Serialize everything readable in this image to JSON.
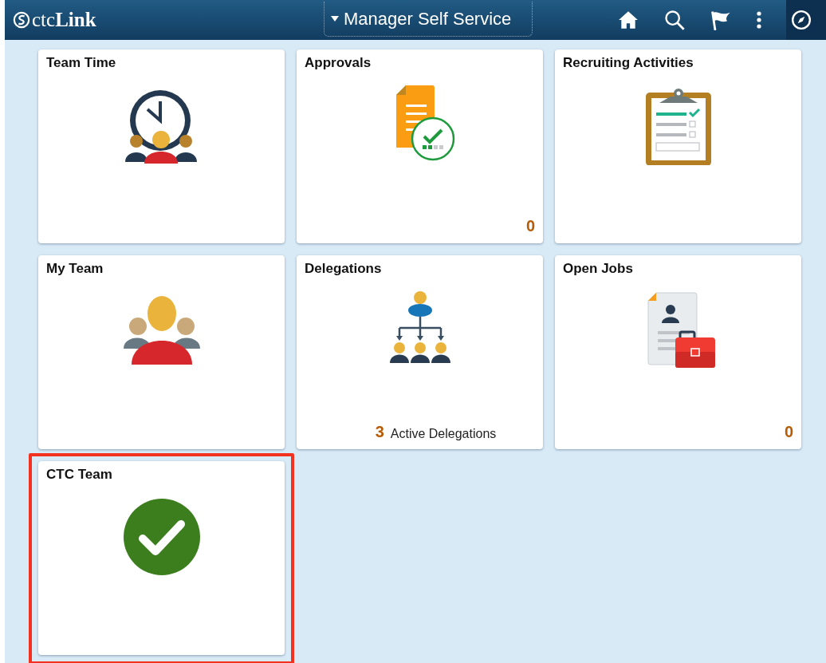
{
  "header": {
    "logo": "ctc**Link**",
    "menu": "Manager Self Service"
  },
  "tiles": [
    {
      "title": "Team Time",
      "kind": "clock",
      "highlighted": false
    },
    {
      "title": "Approvals",
      "kind": "approvals",
      "count": "0",
      "highlighted": false
    },
    {
      "title": "Recruiting Activities",
      "kind": "clipboard",
      "highlighted": false
    },
    {
      "title": "My Team",
      "kind": "team",
      "highlighted": false
    },
    {
      "title": "Delegations",
      "kind": "org",
      "count": "3",
      "count_label": "Active Delegations",
      "highlighted": false
    },
    {
      "title": "Open Jobs",
      "kind": "resume",
      "count": "0",
      "highlighted": false
    },
    {
      "title": "CTC Team",
      "kind": "check",
      "highlighted": true
    }
  ]
}
